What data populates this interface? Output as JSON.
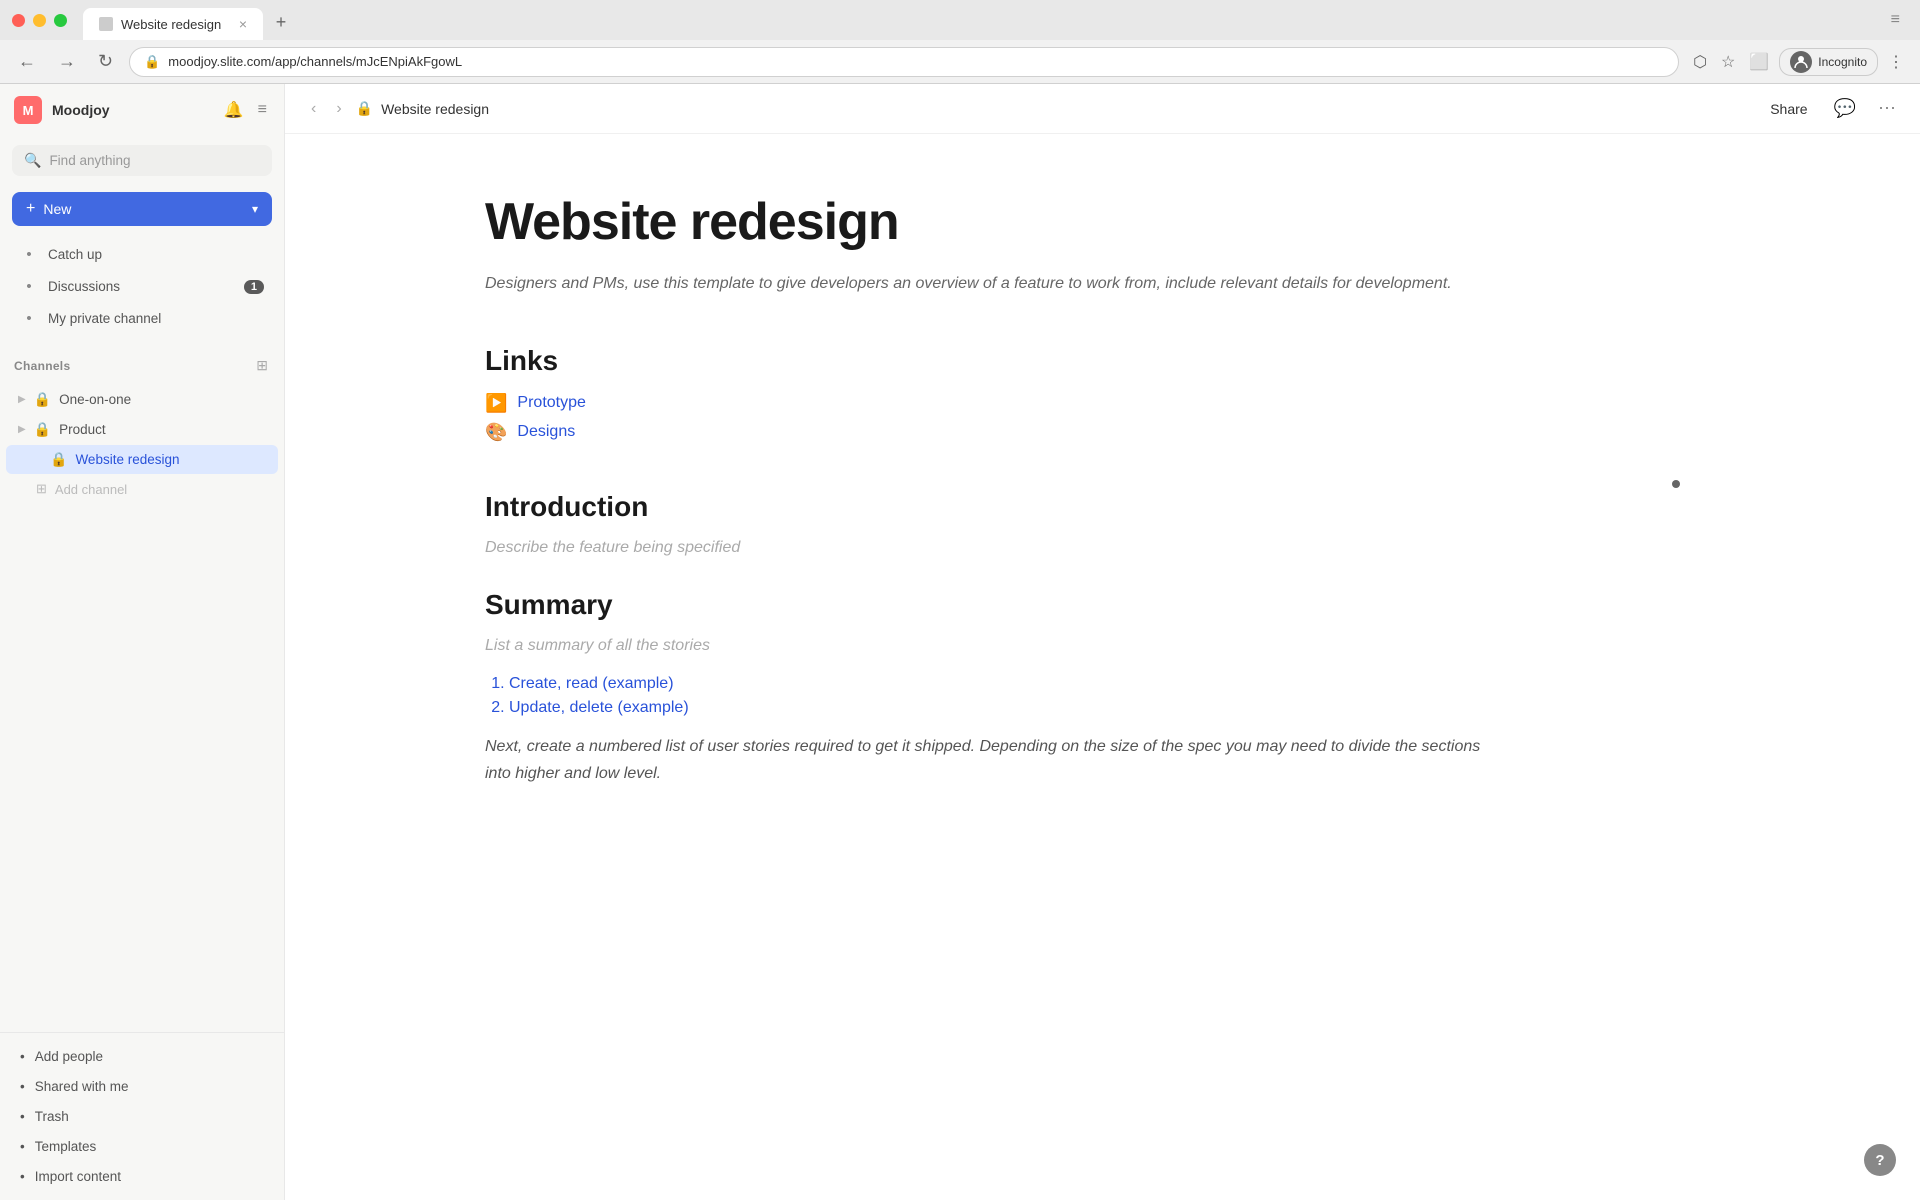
{
  "browser": {
    "tab_title": "Website redesign",
    "tab_close": "×",
    "tab_new": "+",
    "url": "moodjoy.slite.com/app/channels/mJcENpiAkFgowL",
    "nav_back": "←",
    "nav_forward": "→",
    "nav_refresh": "↻",
    "incognito_label": "Incognito",
    "toolbar_more": "⋮"
  },
  "sidebar": {
    "workspace_initial": "M",
    "workspace_name": "Moodjoy",
    "search_placeholder": "Find anything",
    "new_label": "New",
    "nav_items": [
      {
        "id": "catch-up",
        "icon": "🕐",
        "label": "Catch up"
      },
      {
        "id": "discussions",
        "icon": "💬",
        "label": "Discussions",
        "badge": "1"
      },
      {
        "id": "my-private-channel",
        "icon": "🔒",
        "label": "My private channel"
      }
    ],
    "channels_section": "Channels",
    "channels": [
      {
        "id": "one-on-one",
        "icon": "🔒",
        "label": "One-on-one",
        "expanded": false
      },
      {
        "id": "product",
        "icon": "🔒",
        "label": "Product",
        "expanded": false
      },
      {
        "id": "website-redesign",
        "icon": "🔒",
        "label": "Website redesign",
        "active": true
      }
    ],
    "add_channel_label": "Add channel",
    "bottom_items": [
      {
        "id": "add-people",
        "icon": "👤",
        "label": "Add people"
      },
      {
        "id": "shared-with-me",
        "icon": "📤",
        "label": "Shared with me"
      },
      {
        "id": "trash",
        "icon": "🗑",
        "label": "Trash"
      },
      {
        "id": "templates",
        "icon": "🟤",
        "label": "Templates"
      },
      {
        "id": "import-content",
        "icon": "📥",
        "label": "Import content"
      }
    ]
  },
  "doc": {
    "breadcrumb_title": "Website redesign",
    "share_label": "Share",
    "title": "Website redesign",
    "subtitle": "Designers and PMs, use this template to give developers an overview of a feature to work from, include relevant details for development.",
    "links_heading": "Links",
    "links": [
      {
        "id": "prototype",
        "emoji": "▶️",
        "label": "Prototype"
      },
      {
        "id": "designs",
        "emoji": "🎨",
        "label": "Designs"
      }
    ],
    "introduction_heading": "Introduction",
    "introduction_placeholder": "Describe the feature being specified",
    "summary_heading": "Summary",
    "summary_placeholder": "List a summary of all the stories",
    "summary_list": [
      "Create, read (example)",
      "Update, delete (example)"
    ],
    "summary_body": "Next, create a numbered list of user stories required to get it shipped. Depending on the size of the spec you may need to divide the sections into higher and low level."
  }
}
